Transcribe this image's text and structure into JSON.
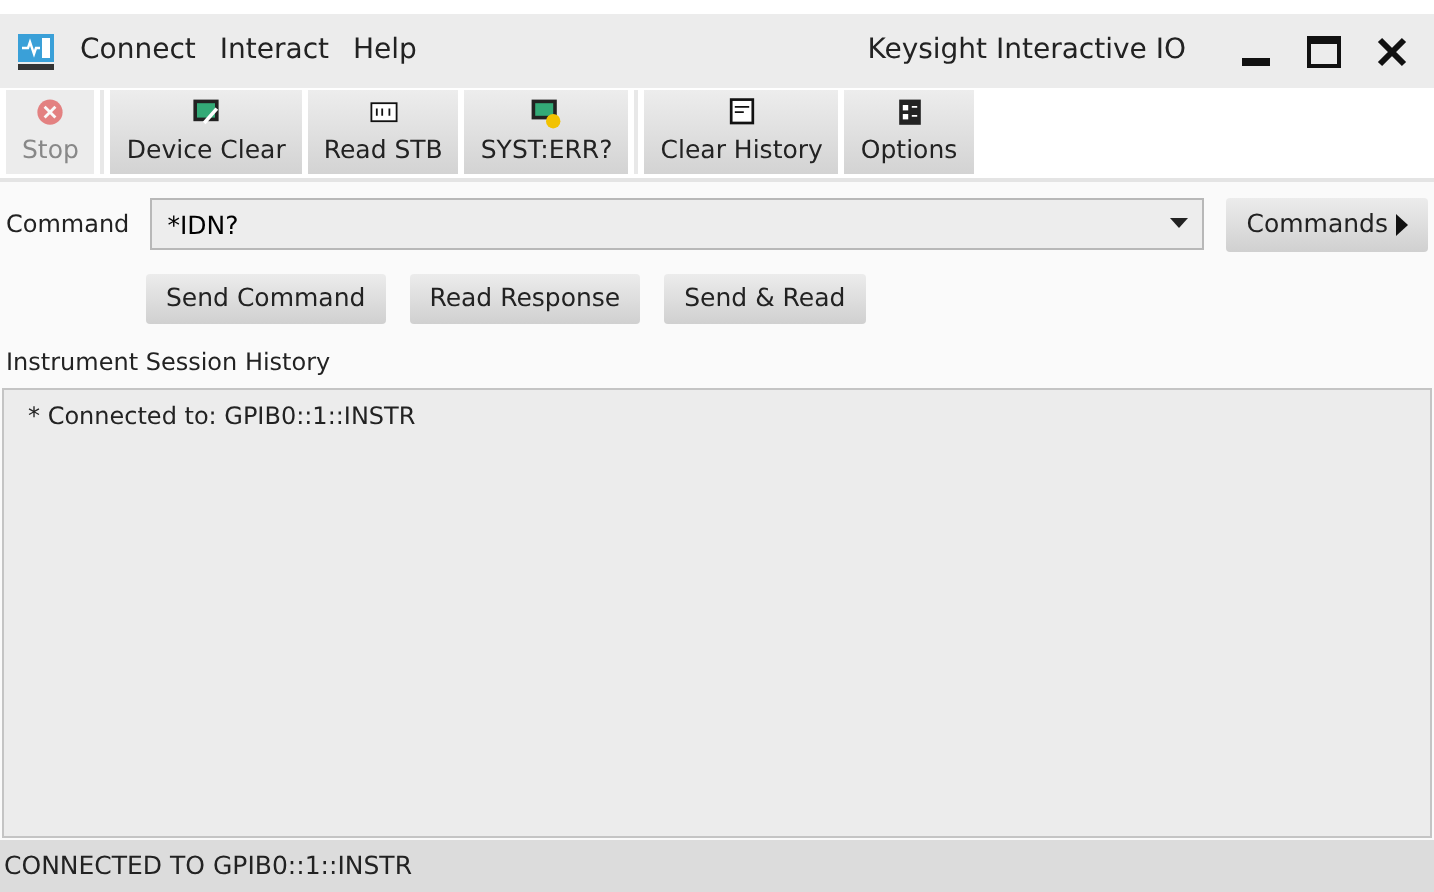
{
  "window": {
    "title": "Keysight Interactive IO"
  },
  "menu": [
    "Connect",
    "Interact",
    "Help"
  ],
  "toolbar": [
    [
      {
        "label": "Stop",
        "disabled": true
      }
    ],
    [
      {
        "label": "Device Clear",
        "disabled": false
      },
      {
        "label": "Read STB",
        "disabled": false
      },
      {
        "label": "SYST:ERR?",
        "disabled": false
      }
    ],
    [
      {
        "label": "Clear History",
        "disabled": false
      },
      {
        "label": "Options",
        "disabled": false
      }
    ]
  ],
  "command": {
    "label": "Command",
    "value": "*IDN?",
    "menu_button": "Commands"
  },
  "actions": [
    "Send Command",
    "Read Response",
    "Send & Read"
  ],
  "history": {
    "label": "Instrument Session History",
    "lines": [
      "* Connected to: GPIB0::1::INSTR"
    ]
  },
  "status_bar": "CONNECTED TO GPIB0::1::INSTR"
}
